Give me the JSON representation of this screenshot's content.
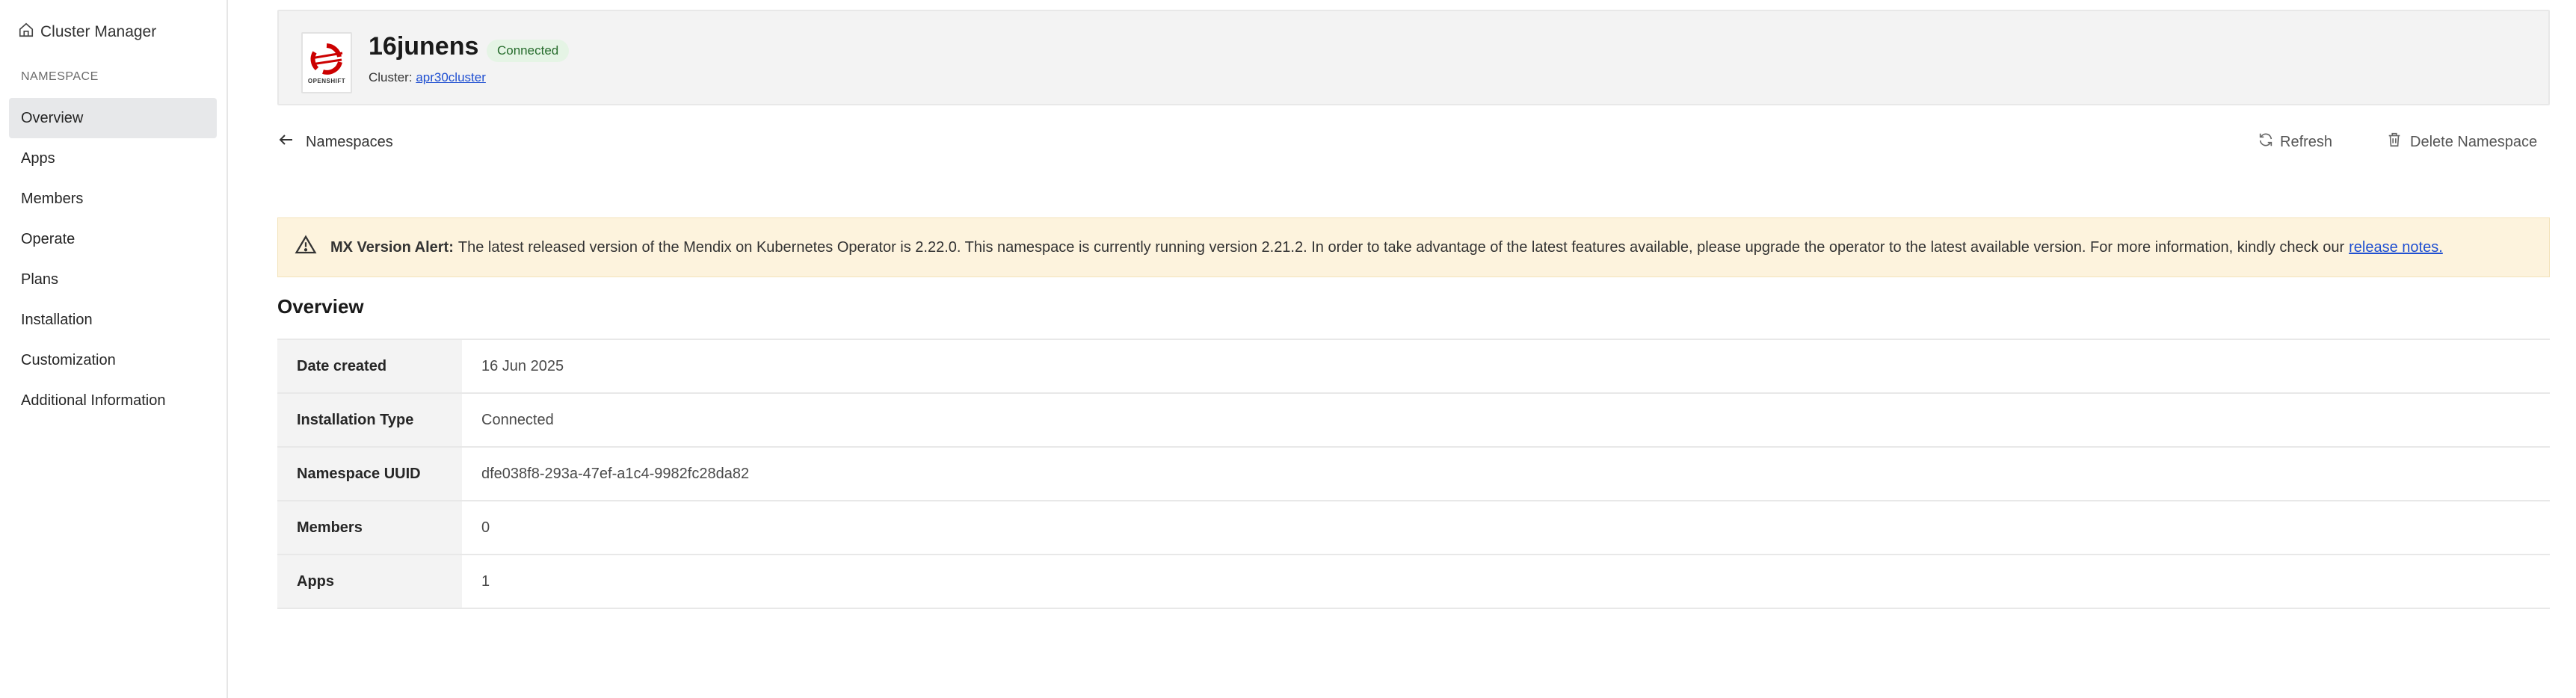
{
  "sidebar": {
    "home_label": "Cluster Manager",
    "section_label": "NAMESPACE",
    "items": [
      {
        "label": "Overview",
        "active": true
      },
      {
        "label": "Apps"
      },
      {
        "label": "Members"
      },
      {
        "label": "Operate"
      },
      {
        "label": "Plans"
      },
      {
        "label": "Installation"
      },
      {
        "label": "Customization"
      },
      {
        "label": "Additional Information"
      }
    ]
  },
  "header": {
    "logo_text": "OPENSHIFT",
    "title": "16junens",
    "status_badge": "Connected",
    "cluster_prefix": "Cluster:",
    "cluster_link": "apr30cluster"
  },
  "nav": {
    "back_label": "Namespaces",
    "refresh_label": "Refresh",
    "delete_label": "Delete Namespace"
  },
  "alert": {
    "title": "MX Version Alert:",
    "message": "The latest released version of the Mendix on Kubernetes Operator is 2.22.0. This namespace is currently running version 2.21.2. In order to take advantage of the latest features available, please upgrade the operator to the latest available version. For more information, kindly check our",
    "link": "release notes."
  },
  "overview": {
    "title": "Overview",
    "rows": [
      {
        "label": "Date created",
        "value": "16 Jun 2025"
      },
      {
        "label": "Installation Type",
        "value": "Connected"
      },
      {
        "label": "Namespace UUID",
        "value": "dfe038f8-293a-47ef-a1c4-9982fc28da82"
      },
      {
        "label": "Members",
        "value": "0"
      },
      {
        "label": "Apps",
        "value": "1"
      }
    ]
  },
  "colors": {
    "alert_bg": "#fdf3dd",
    "badge_bg": "#e5f4e5",
    "link": "#1f4fd1",
    "openshift_red": "#cc0000"
  }
}
